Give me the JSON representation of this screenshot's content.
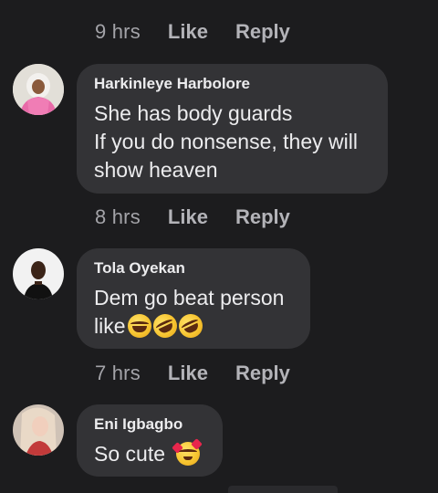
{
  "comments": [
    {
      "author": "",
      "text": "",
      "meta": {
        "time": "9 hrs",
        "like": "Like",
        "reply": "Reply"
      }
    },
    {
      "author": "Harkinleye Harbolore",
      "line1": "She has body guards",
      "line2": "If you do nonsense, they will",
      "line3": "show heaven",
      "meta": {
        "time": "8 hrs",
        "like": "Like",
        "reply": "Reply"
      }
    },
    {
      "author": "Tola Oyekan",
      "line1": "Dem go beat person",
      "line2": "like",
      "emojis": [
        "face-with-tears-of-joy",
        "rolling-on-floor-laughing",
        "rolling-on-floor-laughing"
      ],
      "meta": {
        "time": "7 hrs",
        "like": "Like",
        "reply": "Reply"
      }
    },
    {
      "author": "Eni Igbagbo",
      "line1": "So cute",
      "emojis": [
        "smiling-face-with-hearts"
      ]
    }
  ],
  "colors": {
    "background": "#1c1c1e",
    "bubble": "#333336",
    "meta_text": "#a9a9ad"
  }
}
